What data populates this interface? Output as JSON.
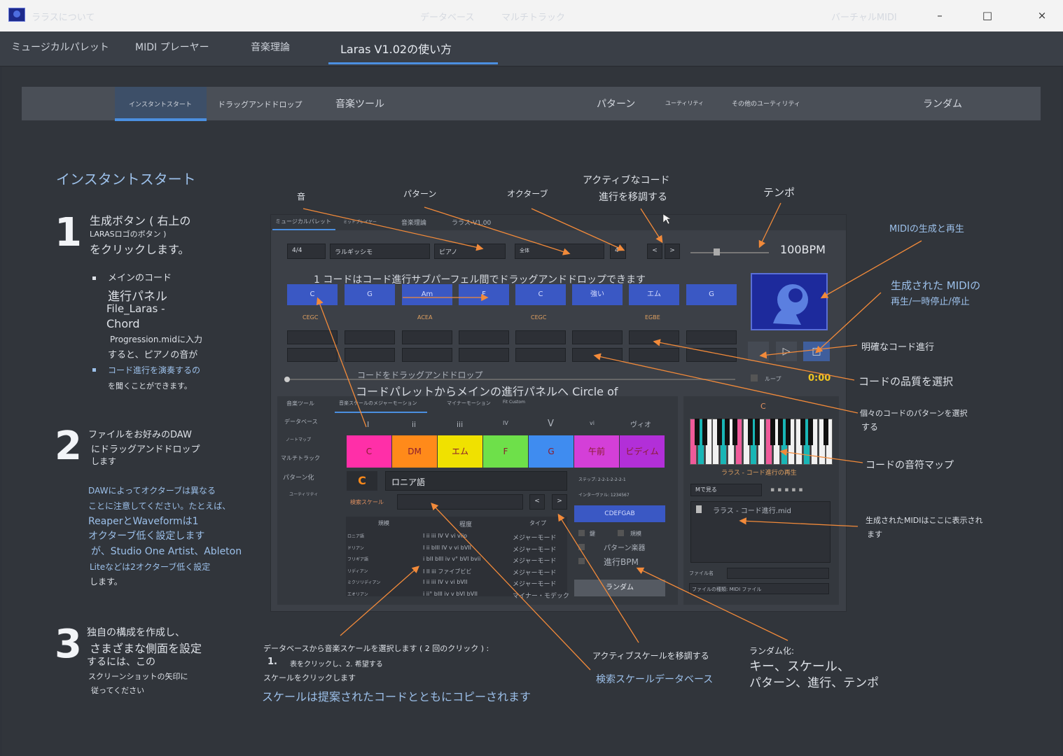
{
  "window": {
    "minimize_glyph": "–",
    "maximize_glyph": "□",
    "close_glyph": "×"
  },
  "main_tabs": [
    {
      "label": "ミュージカルパレット"
    },
    {
      "label": "MIDI プレーヤー"
    },
    {
      "label": "音楽理論"
    },
    {
      "label": "Laras V1.02の使い方"
    }
  ],
  "sub_tabs": [
    {
      "label": "ララスについて"
    },
    {
      "label": "インスタントスタート"
    },
    {
      "label": "ドラッグアンドドロップ"
    },
    {
      "label": "音楽ツール"
    },
    {
      "label": "データベース"
    },
    {
      "label": "マルチトラック"
    },
    {
      "label": "パターン"
    },
    {
      "label": "ユーティリティ"
    },
    {
      "label": "その他のユーティリティ"
    },
    {
      "label": "バーチャルMIDI"
    },
    {
      "label": "ランダム"
    }
  ],
  "page": {
    "title": "インスタントスタート",
    "step1": {
      "number": "1",
      "line1": "生成ボタン ( 右上の",
      "line2": "LARASロゴのボタン )",
      "line3": "をクリックします。",
      "b1_l1": "メインのコード",
      "b1_l2": "進行パネル",
      "b1_l3": "File_Laras -",
      "b1_l4": "Chord",
      "b1_l5": "Progression.midに入力",
      "b1_l6": "すると、ピアノの音が",
      "b2_l1": "コード進行を演奏するの",
      "b2_l2": "を聞くことができます。"
    },
    "step2": {
      "number": "2",
      "line1": "ファイルをお好みのDAW",
      "line2": "にドラッグアンドドロップ",
      "line3": "します",
      "note1": "DAWによってオクターブは異なる",
      "note2": "ことに注意してください。たとえば、",
      "note3": "ReaperとWaveformは1",
      "note4": "オクターブ低く設定します",
      "note5": "が、Studio One Artist、Ableton",
      "note6": "Liteなどは2オクターブ低く設定",
      "note7": "します。"
    },
    "step3": {
      "number": "3",
      "line1": "独自の構成を作成し、",
      "line2": "さまざまな側面を設定",
      "line3": "するには、この",
      "line4": "スクリーンショットの矢印に",
      "line5": "従ってください"
    }
  },
  "annotations": {
    "sound": "音",
    "pattern": "パターン",
    "octave": "オクターブ",
    "transpose_l1": "アクティブなコード",
    "transpose_l2": "進行を移調する",
    "tempo": "テンポ",
    "midi_gen": "MIDIの生成と再生",
    "play_pause_l1": "生成された MIDIの",
    "play_pause_l2": "再生/一時停止/停止",
    "explicit": "明確なコード進行",
    "quality": "コードの品質を選択",
    "each_pattern_l1": "個々のコードのパターンを選択",
    "each_pattern_l2": "する",
    "note_map": "コードの音符マップ",
    "midi_shown_l1": "生成されたMIDIはここに表示され",
    "midi_shown_l2": "ます",
    "db_l1": "データベースから音楽スケールを選択します ( 2 回のクリック ) :",
    "db_num": "1.",
    "db_l2": "表をクリックし、2. 希望する",
    "db_l3": "スケールをクリックします",
    "db_l4": "スケールは提案されたコードとともにコピーされます",
    "active_scale": "アクティブスケールを移調する",
    "search_db": "検索スケールデータベース",
    "random_l1": "ランダム化:",
    "random_l2": "キー、スケール、",
    "random_l3": "パターン、進行、テンポ"
  },
  "app": {
    "tabs": [
      "ミュージカルパレット",
      "ミッドプレイヤー",
      "音楽理論",
      "ララス-V1.00"
    ],
    "combo_meter": "4/4",
    "combo_progression": "ラルギッシモ",
    "combo_instrument": "ピアノ",
    "combo_octave": "全体",
    "octave_value": "4",
    "prev_glyph": "<",
    "next_glyph": ">",
    "bpm": "100BPM",
    "drag_hint": "1 コードはコード進行サブパーフェル間でドラッグアンドドロップできます",
    "chords": [
      "C",
      "G",
      "Am",
      "F",
      "C",
      "強い",
      "エム",
      "G"
    ],
    "chord_notes": [
      "CEGC",
      "",
      "ACEA",
      "",
      "CEGC",
      "",
      "EGBE",
      ""
    ],
    "drag_chord": "コードをドラッグアンドドロップ",
    "palette_to_main": "コードパレットからメインの進行パネルへ Circle of",
    "loop": "ループ",
    "time": "0:00",
    "side_items": [
      "音楽ツール",
      "データベース",
      "ノートマップ",
      "マルチトラック",
      "パターン化",
      "ユーティリティ"
    ],
    "scale_tabs": [
      "音楽スケールのメジャーモーション",
      "マイナーモーション",
      "Fit Custom"
    ],
    "degrees": [
      "I",
      "ii",
      "iii",
      "IV",
      "V",
      "vi",
      "ヴィオ"
    ],
    "palette": [
      {
        "label": "C",
        "color": "#ff2fa8"
      },
      {
        "label": "DM",
        "color": "#ff8a1a"
      },
      {
        "label": "エム",
        "color": "#f0e100"
      },
      {
        "label": "F",
        "color": "#6ee04a"
      },
      {
        "label": "G",
        "color": "#3f8cf0"
      },
      {
        "label": "午前",
        "color": "#d43fd8"
      },
      {
        "label": "ビディム",
        "color": "#b22fd8"
      }
    ],
    "key": "C",
    "mode": "ロニア語",
    "search_label": "検索スケール",
    "table_headers": [
      "規模",
      "程度",
      "タイプ"
    ],
    "table_rows": [
      {
        "name": "ロニア語",
        "deg": "I ii iii IV V vi viio",
        "type": "メジャーモード"
      },
      {
        "name": "ドリアン",
        "deg": "I ii bIII IV v vi bVII",
        "type": "メジャーモード"
      },
      {
        "name": "フリギア語",
        "deg": "i bII bIII iv v° bVI bvii",
        "type": "メジャーモード"
      },
      {
        "name": "リディアン",
        "deg": "I II iii ファイブビビ",
        "type": "メジャーモード"
      },
      {
        "name": "ミクソリディアン",
        "deg": "I ii iii IV v vi bVII",
        "type": "メジャーモード"
      },
      {
        "name": "エオリアン",
        "deg": "i ii° bIII iv v bVI bVII",
        "type": "マイナー・モデック"
      }
    ],
    "step_label": "ステップ: 2-2-1-2-2-2-1",
    "interval_label": "インターヴァル: 1234567",
    "notes_btn": "CDEFGAB",
    "check1": "鍵",
    "check2": "規模",
    "pattern_instr": "パターン楽器",
    "progress_bpm": "進行BPM",
    "random_btn": "ランダム",
    "piano_key": "C",
    "piano_caption": "ララス - コード進行の再生",
    "midi_folder": "Mで見る",
    "midi_file": "ララス - コード進行.mid",
    "file_name_label": "ファイル名",
    "file_type_label": "ファイルの種類: MIDI ファイル"
  }
}
